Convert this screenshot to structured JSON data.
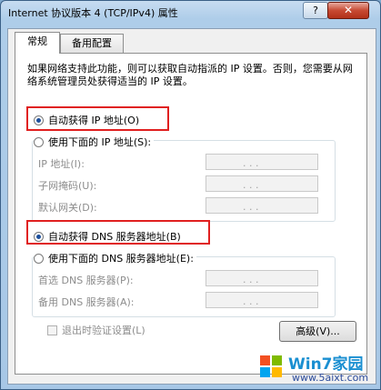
{
  "window": {
    "title": "Internet 协议版本 4 (TCP/IPv4) 属性",
    "help_label": "?",
    "close_label": "✕"
  },
  "tabs": [
    {
      "label": "常规",
      "active": true
    },
    {
      "label": "备用配置",
      "active": false
    }
  ],
  "description": "如果网络支持此功能，则可以获取自动指派的 IP 设置。否则，您需要从网络系统管理员处获得适当的 IP 设置。",
  "ip_section": {
    "auto_label": "自动获得 IP 地址(O)",
    "auto_selected": true,
    "manual_label": "使用下面的 IP 地址(S):",
    "fields": [
      {
        "label": "IP 地址(I):",
        "value": ". . ."
      },
      {
        "label": "子网掩码(U):",
        "value": ". . ."
      },
      {
        "label": "默认网关(D):",
        "value": ". . ."
      }
    ]
  },
  "dns_section": {
    "auto_label": "自动获得 DNS 服务器地址(B)",
    "auto_selected": true,
    "manual_label": "使用下面的 DNS 服务器地址(E):",
    "fields": [
      {
        "label": "首选 DNS 服务器(P):",
        "value": ". . ."
      },
      {
        "label": "备用 DNS 服务器(A):",
        "value": ". . ."
      }
    ]
  },
  "validate_checkbox": {
    "label": "退出时验证设置(L)",
    "checked": false
  },
  "advanced_button": "高级(V)...",
  "watermark": {
    "brand": "Win7家园",
    "url": "www.5aixt.com"
  },
  "colors": {
    "highlight": "#e02020",
    "radio_dot": "#1c4f9c"
  }
}
